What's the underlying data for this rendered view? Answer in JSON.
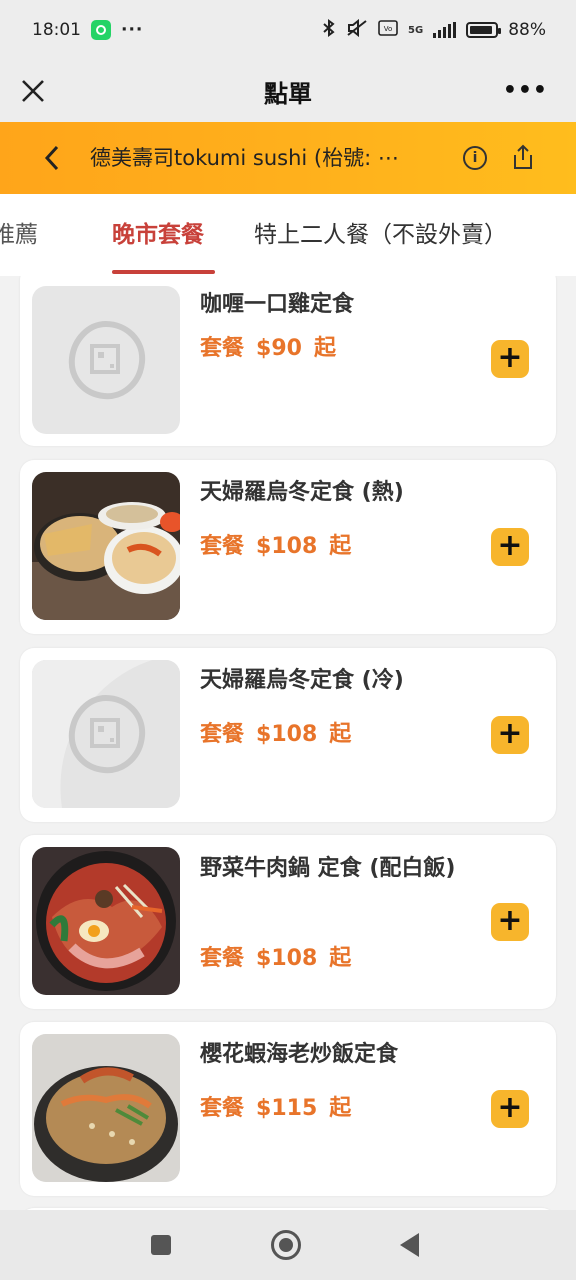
{
  "status_bar": {
    "time": "18:01",
    "more": "···",
    "network": "5G",
    "battery": "88%",
    "icons": [
      "whatsapp-icon",
      "bluetooth-icon",
      "mute-icon",
      "volte-icon",
      "signal-icon",
      "battery-icon"
    ]
  },
  "titlebar": {
    "title": "點單",
    "close_icon": "close-icon",
    "more": "•••"
  },
  "store": {
    "name": "德美壽司tokumi sushi (枱號: ⋯",
    "info_icon": "info-icon",
    "share_icon": "share-icon"
  },
  "tabs": [
    {
      "label": "推薦"
    },
    {
      "label": "晚市套餐",
      "active": true
    },
    {
      "label": "特上二人餐（不設外賣）"
    }
  ],
  "items": [
    {
      "name": "咖喱一口雞定食",
      "prefix": "套餐",
      "price": "$90",
      "suffix": "起",
      "image": "placeholder"
    },
    {
      "name": "天婦羅烏冬定食 (熱)",
      "prefix": "套餐",
      "price": "$108",
      "suffix": "起",
      "image": "tempura-udon-photo"
    },
    {
      "name": "天婦羅烏冬定食 (冷)",
      "prefix": "套餐",
      "price": "$108",
      "suffix": "起",
      "image": "placeholder"
    },
    {
      "name": "野菜牛肉鍋 定食 (配白飯)",
      "prefix": "套餐",
      "price": "$108",
      "suffix": "起",
      "image": "sukiyaki-photo"
    },
    {
      "name": "櫻花蝦海老炒飯定食",
      "prefix": "套餐",
      "price": "$115",
      "suffix": "起",
      "image": "fried-rice-photo"
    }
  ],
  "add_label": "+",
  "colors": {
    "accent": "#ffb21c",
    "active_tab": "#c8413a",
    "price": "#e8742a",
    "add_button": "#f7b52c"
  }
}
